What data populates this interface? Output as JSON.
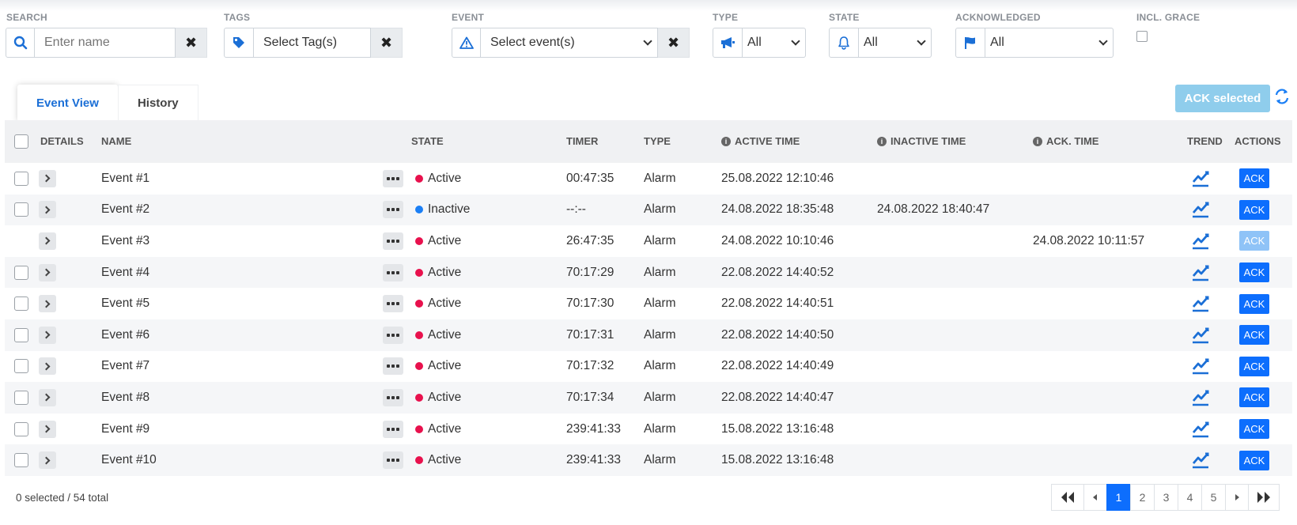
{
  "filters": {
    "search": {
      "label": "SEARCH",
      "placeholder": "Enter name"
    },
    "tags": {
      "label": "TAGS",
      "value": "Select Tag(s)"
    },
    "event": {
      "label": "EVENT",
      "value": "Select event(s)"
    },
    "type": {
      "label": "TYPE",
      "value": "All"
    },
    "state": {
      "label": "STATE",
      "value": "All"
    },
    "acknowledged": {
      "label": "ACKNOWLEDGED",
      "value": "All"
    },
    "grace": {
      "label": "INCL. GRACE"
    }
  },
  "tabs": [
    {
      "label": "Event View",
      "active": true
    },
    {
      "label": "History",
      "active": false
    }
  ],
  "ack_selected_label": "ACK selected",
  "columns": {
    "details": "DETAILS",
    "name": "NAME",
    "state": "STATE",
    "timer": "TIMER",
    "type": "TYPE",
    "active_time": "ACTIVE TIME",
    "inactive_time": "INACTIVE TIME",
    "ack_time": "ACK. TIME",
    "trend": "TREND",
    "actions": "ACTIONS"
  },
  "rows": [
    {
      "name": "Event #1",
      "state": "Active",
      "timer": "00:47:35",
      "type": "Alarm",
      "active_time": "25.08.2022 12:10:46",
      "inactive_time": "",
      "ack_time": "",
      "ack": "ACK",
      "selectable": true,
      "acked": false
    },
    {
      "name": "Event #2",
      "state": "Inactive",
      "timer": "--:--",
      "type": "Alarm",
      "active_time": "24.08.2022 18:35:48",
      "inactive_time": "24.08.2022 18:40:47",
      "ack_time": "",
      "ack": "ACK",
      "selectable": true,
      "acked": false
    },
    {
      "name": "Event #3",
      "state": "Active",
      "timer": "26:47:35",
      "type": "Alarm",
      "active_time": "24.08.2022 10:10:46",
      "inactive_time": "",
      "ack_time": "24.08.2022 10:11:57",
      "ack": "ACK",
      "selectable": false,
      "acked": true
    },
    {
      "name": "Event #4",
      "state": "Active",
      "timer": "70:17:29",
      "type": "Alarm",
      "active_time": "22.08.2022 14:40:52",
      "inactive_time": "",
      "ack_time": "",
      "ack": "ACK",
      "selectable": true,
      "acked": false
    },
    {
      "name": "Event #5",
      "state": "Active",
      "timer": "70:17:30",
      "type": "Alarm",
      "active_time": "22.08.2022 14:40:51",
      "inactive_time": "",
      "ack_time": "",
      "ack": "ACK",
      "selectable": true,
      "acked": false
    },
    {
      "name": "Event #6",
      "state": "Active",
      "timer": "70:17:31",
      "type": "Alarm",
      "active_time": "22.08.2022 14:40:50",
      "inactive_time": "",
      "ack_time": "",
      "ack": "ACK",
      "selectable": true,
      "acked": false
    },
    {
      "name": "Event #7",
      "state": "Active",
      "timer": "70:17:32",
      "type": "Alarm",
      "active_time": "22.08.2022 14:40:49",
      "inactive_time": "",
      "ack_time": "",
      "ack": "ACK",
      "selectable": true,
      "acked": false
    },
    {
      "name": "Event #8",
      "state": "Active",
      "timer": "70:17:34",
      "type": "Alarm",
      "active_time": "22.08.2022 14:40:47",
      "inactive_time": "",
      "ack_time": "",
      "ack": "ACK",
      "selectable": true,
      "acked": false
    },
    {
      "name": "Event #9",
      "state": "Active",
      "timer": "239:41:33",
      "type": "Alarm",
      "active_time": "15.08.2022 13:16:48",
      "inactive_time": "",
      "ack_time": "",
      "ack": "ACK",
      "selectable": true,
      "acked": false
    },
    {
      "name": "Event #10",
      "state": "Active",
      "timer": "239:41:33",
      "type": "Alarm",
      "active_time": "15.08.2022 13:16:48",
      "inactive_time": "",
      "ack_time": "",
      "ack": "ACK",
      "selectable": true,
      "acked": false
    }
  ],
  "footer_text": "0 selected / 54 total",
  "pagination": {
    "pages": [
      "1",
      "2",
      "3",
      "4",
      "5"
    ],
    "current": "1"
  },
  "colors": {
    "primary": "#0d6efd",
    "active_dot": "#e8114d",
    "inactive_dot": "#1b7ff5",
    "ack_disabled": "#8fc3f7",
    "ack_selected_bg": "#8fcdec"
  },
  "icons": {
    "search": "search-icon",
    "tags": "tag-icon",
    "event": "warning-triangle-icon",
    "type": "megaphone-icon",
    "state": "bell-icon",
    "acknowledged": "flag-icon",
    "refresh": "refresh-icon",
    "trend": "trend-chart-icon"
  }
}
